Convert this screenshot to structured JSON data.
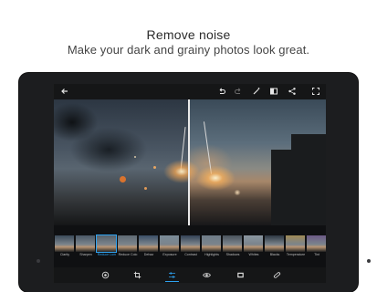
{
  "headline": "Remove noise",
  "subline": "Make your dark and grainy photos look great.",
  "topbar_icons": [
    "back-arrow-icon",
    "undo-icon",
    "redo-icon",
    "magic-wand-icon",
    "compare-icon",
    "share-icon",
    "fullscreen-icon"
  ],
  "adjustments": [
    {
      "label": "Clarity",
      "selected": false
    },
    {
      "label": "Sharpen",
      "selected": false
    },
    {
      "label": "Reduce Lum",
      "selected": true
    },
    {
      "label": "Reduce Colo",
      "selected": false
    },
    {
      "label": "Dehaz",
      "selected": false
    },
    {
      "label": "Exposure",
      "selected": false
    },
    {
      "label": "Contrast",
      "selected": false
    },
    {
      "label": "Highlights",
      "selected": false
    },
    {
      "label": "Shadows",
      "selected": false
    },
    {
      "label": "Whites",
      "selected": false
    },
    {
      "label": "Blacks",
      "selected": false
    },
    {
      "label": "Temperature",
      "selected": false
    },
    {
      "label": "Tint",
      "selected": false
    }
  ],
  "bottom_tools": [
    {
      "icon": "looks-icon",
      "active": false
    },
    {
      "icon": "crop-icon",
      "active": false
    },
    {
      "icon": "adjustments-icon",
      "active": true
    },
    {
      "icon": "eye-icon",
      "active": false
    },
    {
      "icon": "frame-icon",
      "active": false
    },
    {
      "icon": "bandage-icon",
      "active": false
    }
  ],
  "accent_color": "#2ea3f2"
}
